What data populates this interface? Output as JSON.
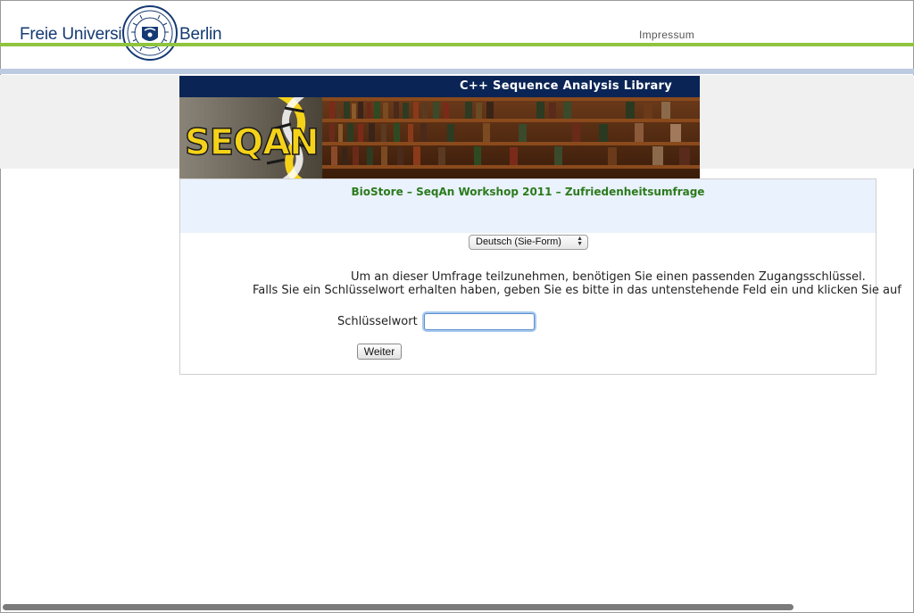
{
  "header": {
    "brand_left": "Freie Universität",
    "brand_right": "Berlin",
    "impressum": "Impressum"
  },
  "banner": {
    "title": "C++ Sequence Analysis Library",
    "logo_text": "SEQAN"
  },
  "survey": {
    "title": "BioStore – SeqAn Workshop 2011 – Zufriedenheitsumfrage",
    "language_selected": "Deutsch (Sie-Form)",
    "message_line1": "Um an dieser Umfrage teilzunehmen, benötigen Sie einen passenden Zugangsschlüssel.",
    "message_line2": "Falls Sie ein Schlüsselwort erhalten haben, geben Sie es bitte in das untenstehende Feld ein und klicken Sie auf",
    "key_label": "Schlüsselwort",
    "key_value": "",
    "submit_label": "Weiter"
  },
  "colors": {
    "fu_blue": "#153a73",
    "fu_green": "#8fc43e",
    "banner_navy": "#0a2456",
    "title_green": "#2b7a1c"
  },
  "icons": {
    "seal": "university-seal-icon",
    "select_arrows": "select-arrows-icon"
  }
}
